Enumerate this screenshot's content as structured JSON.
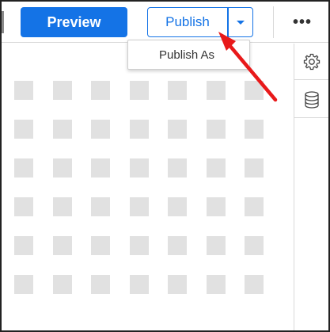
{
  "toolbar": {
    "preview_label": "Preview",
    "publish_label": "Publish",
    "more_label": "•••"
  },
  "publish_menu": {
    "items": [
      {
        "label": "Publish As"
      }
    ]
  },
  "rail": {
    "items": [
      {
        "icon": "gear-icon"
      },
      {
        "icon": "database-icon"
      }
    ]
  },
  "canvas": {
    "grid_rows": 6,
    "grid_cols": 7
  },
  "annotation": {
    "arrow_color": "#e8191a"
  },
  "colors": {
    "accent": "#1473e6",
    "placeholder": "#e1e1e1"
  }
}
